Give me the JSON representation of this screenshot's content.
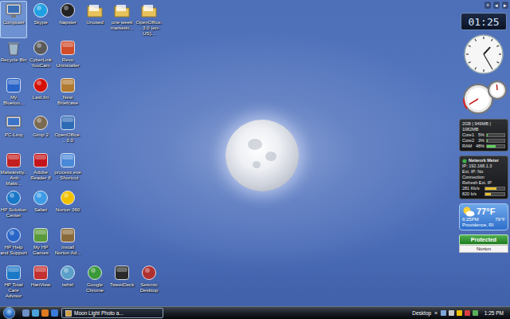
{
  "desktop": {
    "icons": [
      {
        "label": "Computer",
        "selected": true
      },
      {
        "label": "Skype",
        "selected": false
      },
      {
        "label": "Napster",
        "selected": false
      },
      {
        "label": "Unused",
        "selected": false
      },
      {
        "label": "one week marketin...",
        "selected": false
      },
      {
        "label": "OpenOffice... 3.0 (en-US)...",
        "selected": false
      },
      {
        "label": "Recycle Bin",
        "selected": false
      },
      {
        "label": "CyberLink YouCam",
        "selected": false
      },
      {
        "label": "Revo Uninstaller",
        "selected": false
      },
      {
        "label": "My Bluetoo...",
        "selected": false
      },
      {
        "label": "Last.fm",
        "selected": false
      },
      {
        "label": "New Briefcase",
        "selected": false
      },
      {
        "label": "PC-Linq",
        "selected": false
      },
      {
        "label": "Gimp 2",
        "selected": false
      },
      {
        "label": "OpenOffice... 3.0",
        "selected": false
      },
      {
        "label": "Malwareby... Anti-Malw...",
        "selected": false
      },
      {
        "label": "Adobe Reader 8",
        "selected": false
      },
      {
        "label": "process.exe - Shortcut",
        "selected": false
      },
      {
        "label": "HP Solution Center",
        "selected": false
      },
      {
        "label": "Safari",
        "selected": false
      },
      {
        "label": "Norton 360",
        "selected": false
      },
      {
        "label": "HP Help and Support",
        "selected": false
      },
      {
        "label": "My HP Games",
        "selected": false
      },
      {
        "label": "Install Norton Ad...",
        "selected": false
      },
      {
        "label": "HP Total Care Advisor",
        "selected": false
      },
      {
        "label": "HanView",
        "selected": false
      },
      {
        "label": "twhirl",
        "selected": false
      },
      {
        "label": "Google Chrome",
        "selected": false
      },
      {
        "label": "TweetDeck",
        "selected": false
      },
      {
        "label": "Seismic Desktop",
        "selected": false
      }
    ]
  },
  "gadgets": {
    "controls": [
      "+",
      "◂",
      "▸"
    ],
    "digital_clock": {
      "time": "01:25"
    },
    "analog_clock": {
      "hour": 1,
      "minute": 25
    },
    "cpu_meter": {
      "cpu_level": 0.05,
      "ram_level": 0.48
    },
    "system_monitor": {
      "header": "2GB | 949MB | 1082MB",
      "rows": [
        {
          "label": "Core1",
          "reading": "5%",
          "level": 0.05
        },
        {
          "label": "Core2",
          "reading": "3%",
          "level": 0.03
        },
        {
          "label": "RAM",
          "reading": "48%",
          "level": 0.48
        }
      ]
    },
    "network_meter": {
      "title": "Network Meter",
      "lines": [
        "IP: 192.168.1.3",
        "Ext. IP: No Connection",
        "Refresh Ext. IP"
      ],
      "readings": [
        {
          "reading": "281 Kb/s",
          "level": 0.6
        },
        {
          "reading": "820 b/s",
          "level": 0.3
        }
      ]
    },
    "weather": {
      "temperature": "77°F",
      "time": "6:25PM",
      "high": "79°F",
      "location": "Providence, RI"
    },
    "norton": {
      "status": "Protected",
      "brand": "Norton"
    }
  },
  "taskbar": {
    "tasks": [
      {
        "label": "Moon Light Photo a...",
        "selected": true
      }
    ],
    "toolbar": "Desktop",
    "chevron": "»",
    "clock": "1:25 PM"
  }
}
